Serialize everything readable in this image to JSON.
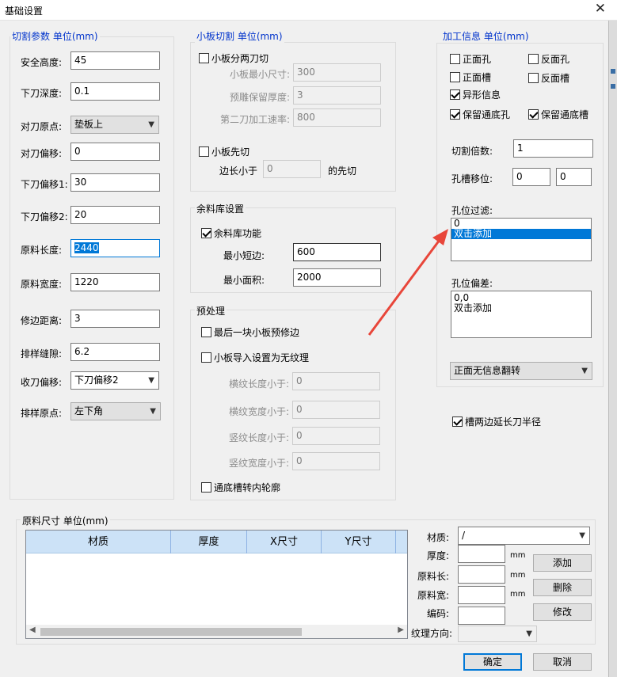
{
  "window": {
    "title": "基础设置",
    "close_glyph": "✕"
  },
  "cut_params": {
    "legend": "切割参数 单位(mm)",
    "safe_height": {
      "label": "安全高度:",
      "value": "45"
    },
    "cut_depth": {
      "label": "下刀深度:",
      "value": "0.1"
    },
    "tool_origin": {
      "label": "对刀原点:",
      "value": "垫板上"
    },
    "tool_offset": {
      "label": "对刀偏移:",
      "value": "0"
    },
    "down_offset1": {
      "label": "下刀偏移1:",
      "value": "30"
    },
    "down_offset2": {
      "label": "下刀偏移2:",
      "value": "20"
    },
    "raw_length": {
      "label": "原料长度:",
      "value": "2440"
    },
    "raw_width": {
      "label": "原料宽度:",
      "value": "1220"
    },
    "trim_distance": {
      "label": "修边距离:",
      "value": "3"
    },
    "layout_gap": {
      "label": "排样缝隙:",
      "value": "6.2"
    },
    "retract_offset": {
      "label": "收刀偏移:",
      "value": "下刀偏移2"
    },
    "layout_origin": {
      "label": "排样原点:",
      "value": "左下角"
    }
  },
  "small_board": {
    "legend": "小板切割 单位(mm)",
    "two_pass": {
      "label": "小板分两刀切",
      "checked": false
    },
    "min_size": {
      "label": "小板最小尺寸:",
      "value": "300"
    },
    "reserve_thickness": {
      "label": "预雕保留厚度:",
      "value": "3"
    },
    "second_speed": {
      "label": "第二刀加工速率:",
      "value": "800"
    },
    "cut_first": {
      "label": "小板先切",
      "checked": false
    },
    "edge_less": {
      "label": "边长小于",
      "value": "0",
      "suffix": "的先切"
    }
  },
  "remnant": {
    "legend": "余料库设置",
    "enable": {
      "label": "余料库功能",
      "checked": true
    },
    "min_short": {
      "label": "最小短边:",
      "value": "600"
    },
    "min_area": {
      "label": "最小面积:",
      "value": "2000"
    }
  },
  "preprocess": {
    "legend": "预处理",
    "last_trim": {
      "label": "最后一块小板预修边",
      "checked": false
    },
    "no_grain": {
      "label": "小板导入设置为无纹理",
      "checked": false
    },
    "h_len": {
      "label": "横纹长度小于:",
      "value": "0"
    },
    "h_wid": {
      "label": "横纹宽度小于:",
      "value": "0"
    },
    "v_len": {
      "label": "竖纹长度小于:",
      "value": "0"
    },
    "v_wid": {
      "label": "竖纹宽度小于:",
      "value": "0"
    },
    "slot_contour": {
      "label": "通底槽转内轮廓",
      "checked": false
    }
  },
  "process_info": {
    "legend": "加工信息 单位(mm)",
    "front_hole": {
      "label": "正面孔",
      "checked": false
    },
    "back_hole": {
      "label": "反面孔",
      "checked": false
    },
    "front_slot": {
      "label": "正面槽",
      "checked": false
    },
    "back_slot": {
      "label": "反面槽",
      "checked": false
    },
    "odd_shape": {
      "label": "异形信息",
      "checked": true
    },
    "keep_thru_hole": {
      "label": "保留通底孔",
      "checked": true
    },
    "keep_thru_slot": {
      "label": "保留通底槽",
      "checked": true
    },
    "cut_multiple": {
      "label": "切割倍数:",
      "value": "1"
    },
    "hole_shift": {
      "label": "孔槽移位:",
      "x": "0",
      "y": "0"
    },
    "hole_filter": {
      "label": "孔位过滤:",
      "items": [
        "0",
        "双击添加"
      ]
    },
    "hole_dev": {
      "label": "孔位偏差:",
      "items": [
        "0,0",
        "双击添加"
      ]
    },
    "flip_mode": {
      "value": "正面无信息翻转"
    },
    "extend_slot": {
      "label": "槽两边延长刀半径",
      "checked": true
    }
  },
  "material": {
    "legend": "原料尺寸 单位(mm)",
    "columns": [
      "材质",
      "厚度",
      "X尺寸",
      "Y尺寸"
    ],
    "mat_label": "材质:",
    "mat_value": "/",
    "thick_label": "厚度:",
    "len_label": "原料长:",
    "wid_label": "原料宽:",
    "code_label": "编码:",
    "grain_label": "纹理方向:",
    "unit": "mm",
    "add": "添加",
    "delete": "删除",
    "modify": "修改"
  },
  "footer": {
    "ok": "确定",
    "cancel": "取消"
  },
  "colors": {
    "accent": "#0078d7",
    "legend": "#0033cc",
    "arrow": "#e8463a"
  }
}
